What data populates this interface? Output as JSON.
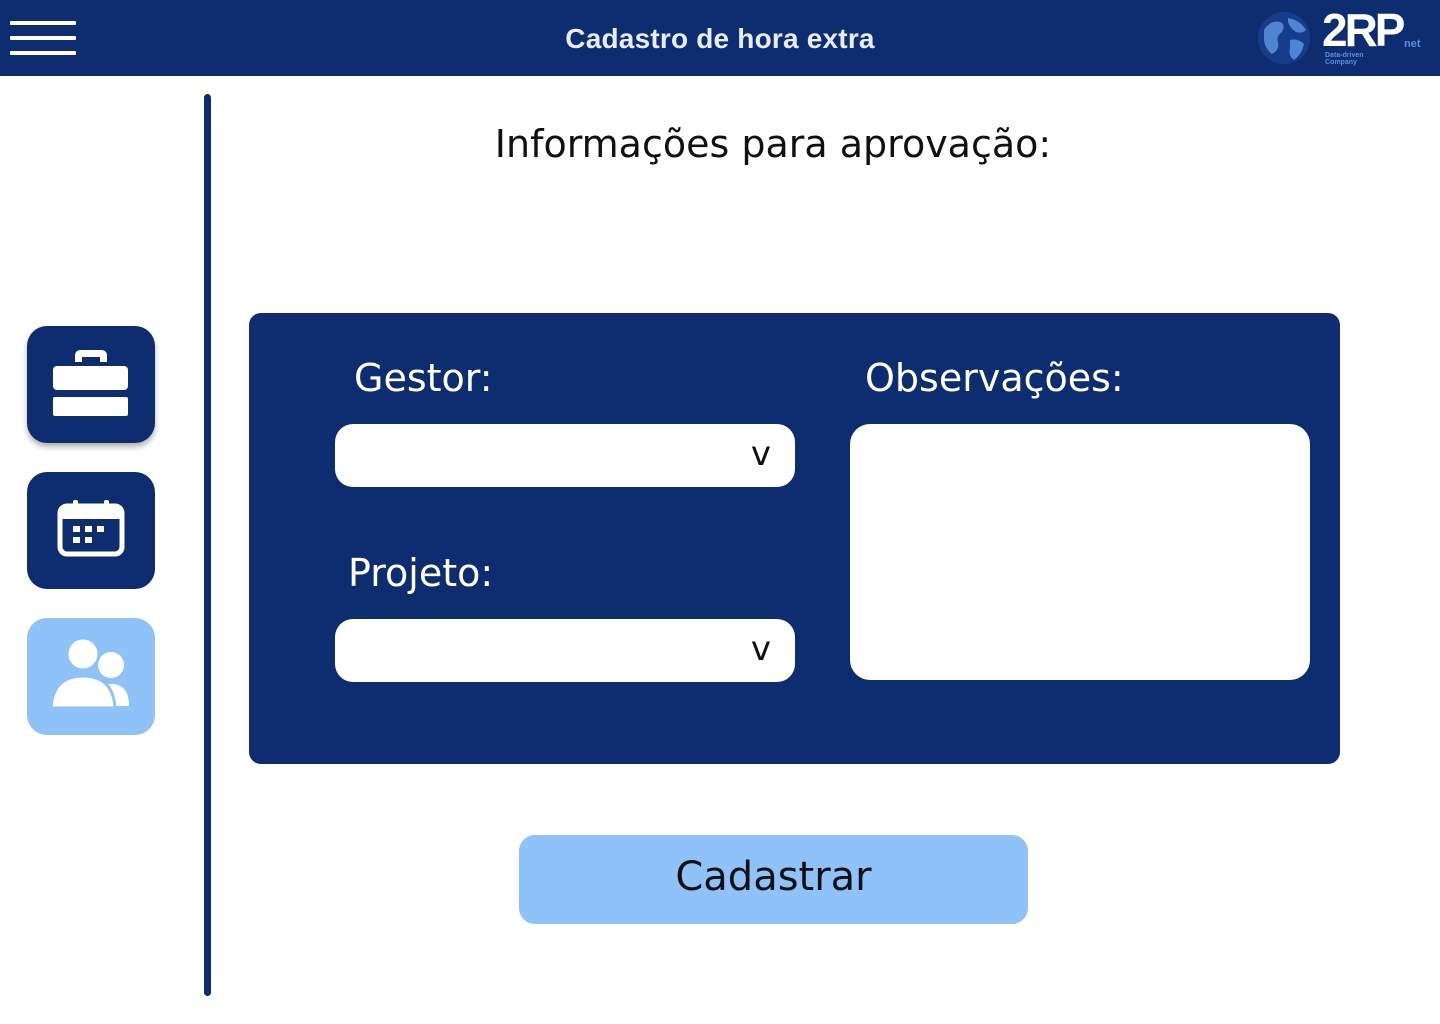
{
  "header": {
    "title": "Cadastro de hora extra",
    "menu_icon": "hamburger-menu-icon",
    "background_color": "#0d2d70"
  },
  "logo": {
    "brand": "2RP",
    "suffix": "net",
    "tagline": "Data-driven Company"
  },
  "sidebar": {
    "items": [
      {
        "icon": "briefcase-icon",
        "active": false,
        "color": "#0d2d70"
      },
      {
        "icon": "calendar-icon",
        "active": false,
        "color": "#0d2d70"
      },
      {
        "icon": "users-icon",
        "active": true,
        "color": "#8ec2f8"
      }
    ]
  },
  "main": {
    "title": "Informações para aprovação:",
    "form": {
      "gestor": {
        "label": "Gestor:",
        "value": "",
        "chevron": "v"
      },
      "projeto": {
        "label": "Projeto:",
        "value": "",
        "chevron": "v"
      },
      "observacoes": {
        "label": "Observações:",
        "value": ""
      }
    },
    "submit_label": "Cadastrar"
  },
  "colors": {
    "primary": "#0d2d70",
    "accent": "#8ec2f8",
    "background": "#ffffff"
  }
}
